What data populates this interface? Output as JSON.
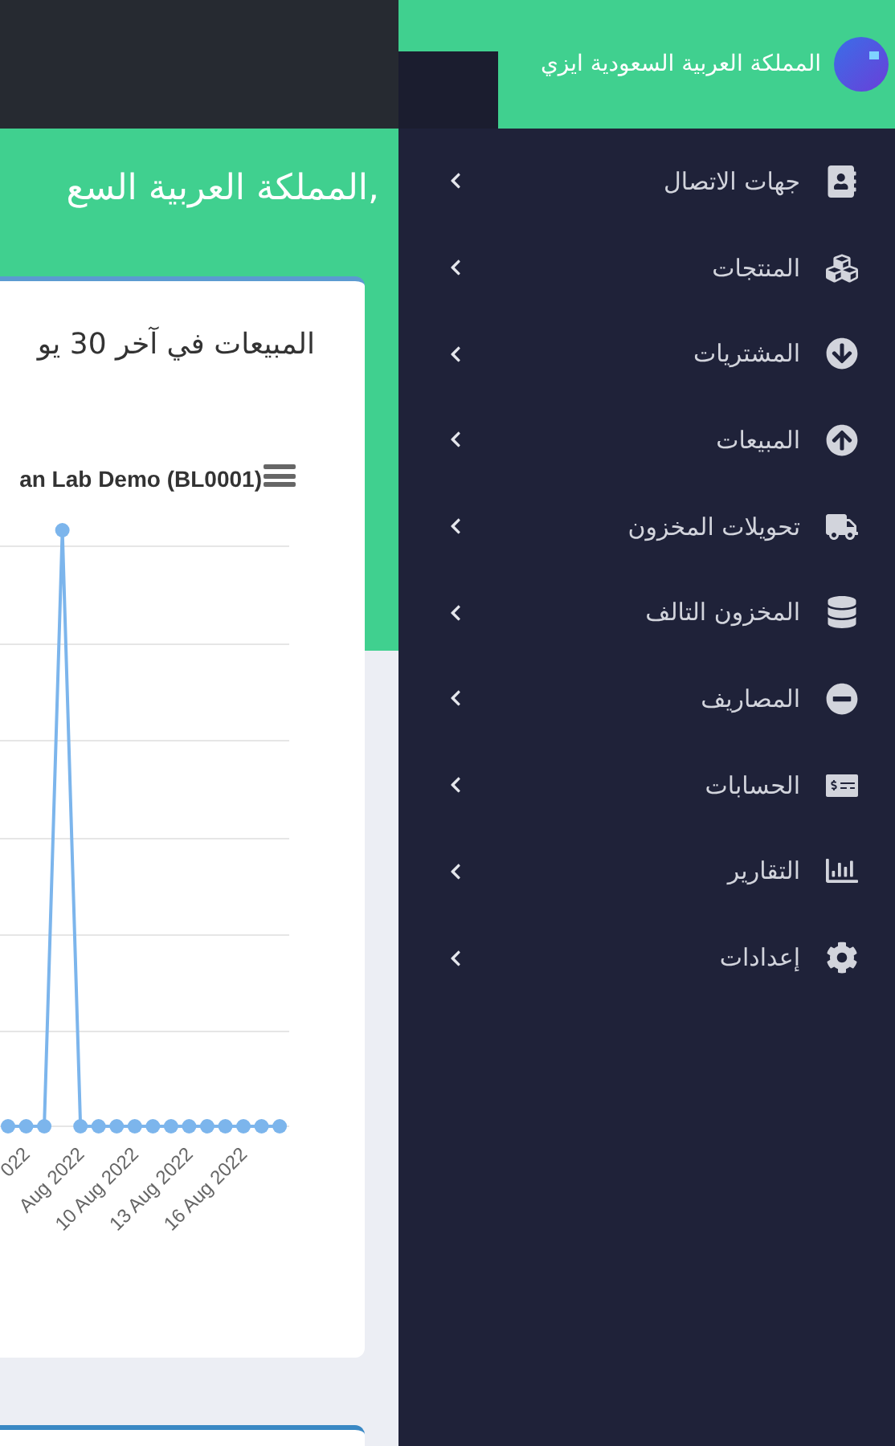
{
  "brand": {
    "title": "المملكة العربية السعودية ايزي"
  },
  "sidebar": {
    "items": [
      {
        "label": "جهات الاتصال"
      },
      {
        "label": "المنتجات"
      },
      {
        "label": "المشتريات"
      },
      {
        "label": "المبيعات"
      },
      {
        "label": "تحويلات المخزون"
      },
      {
        "label": "المخزون التالف"
      },
      {
        "label": "المصاريف"
      },
      {
        "label": "الحسابات"
      },
      {
        "label": "التقارير"
      },
      {
        "label": "إعدادات"
      }
    ]
  },
  "main": {
    "heading": ",المملكة العربية السع",
    "card": {
      "title": "المبيعات في آخر 30 يو",
      "chart": {
        "title": "an Lab Demo (BL0001)",
        "x_labels": [
          "022",
          "Aug 2022",
          "10 Aug 2022",
          "13 Aug 2022",
          "16 Aug 2022"
        ]
      }
    }
  }
}
